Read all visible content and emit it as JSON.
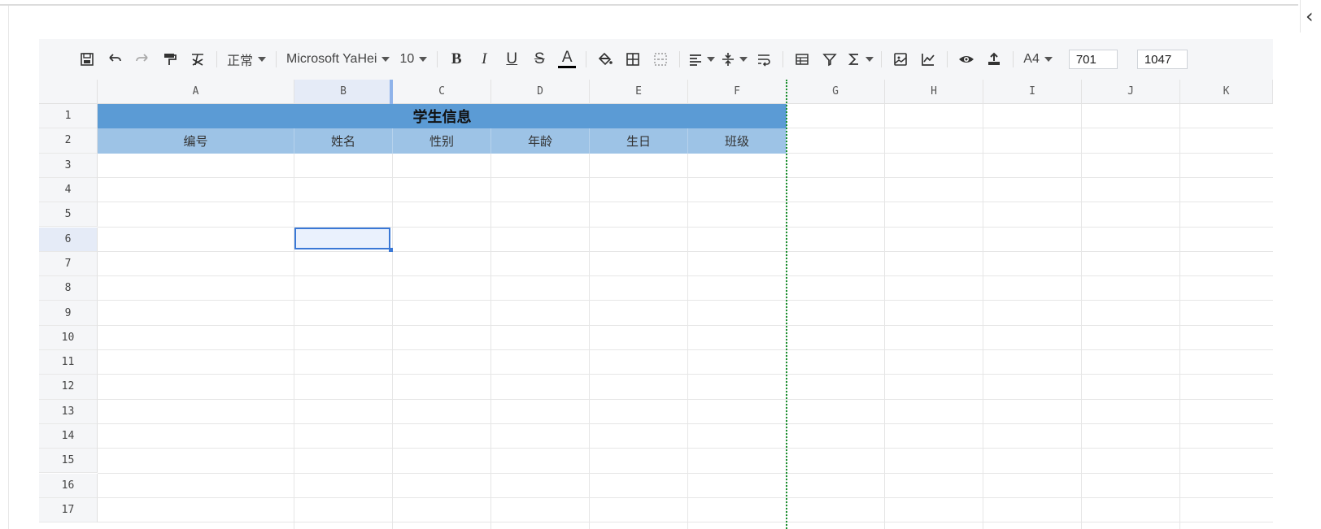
{
  "toolbar": {
    "style_select": "正常",
    "font_family": "Microsoft YaHei",
    "font_size": "10",
    "bold": "B",
    "italic": "I",
    "underline": "U",
    "strike": "S",
    "font_color": "A",
    "paper_size": "A4",
    "width_value": "701",
    "height_value": "1047"
  },
  "columns": [
    "A",
    "B",
    "C",
    "D",
    "E",
    "F",
    "G",
    "H",
    "I",
    "J",
    "K"
  ],
  "rows": [
    "1",
    "2",
    "3",
    "4",
    "5",
    "6",
    "7",
    "8",
    "9",
    "10",
    "11",
    "12",
    "13",
    "14",
    "15",
    "16",
    "17"
  ],
  "table": {
    "title": "学生信息",
    "headers": [
      "编号",
      "姓名",
      "性别",
      "年龄",
      "生日",
      "班级"
    ]
  },
  "selection": {
    "cell": "B6",
    "active_column": "B",
    "active_row": "6"
  },
  "colors": {
    "title_fill": "#5b9bd5",
    "header_fill": "#9dc3e6",
    "selection": "#3a78d6",
    "print_boundary": "#1a8f2e"
  },
  "side_toggle": "‹"
}
